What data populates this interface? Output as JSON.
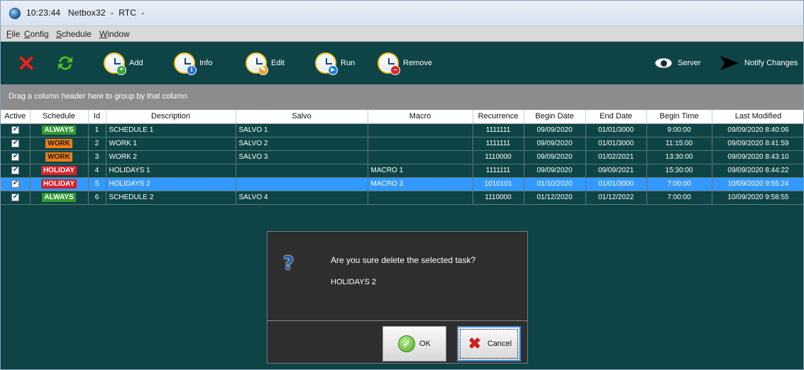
{
  "window": {
    "title": "10:23:44   Netbox32  -  RTC  -"
  },
  "menu": {
    "items": [
      "File",
      "Config",
      "Schedule",
      "Window"
    ]
  },
  "toolbar": {
    "add_label": "Add",
    "info_label": "Info",
    "edit_label": "Edit",
    "run_label": "Run",
    "remove_label": "Remove",
    "server_label": "Server",
    "notify_label": "Notify Changes"
  },
  "group_panel": {
    "hint": "Drag a column header here to group by that column"
  },
  "grid": {
    "columns": [
      "Active",
      "Schedule",
      "Id",
      "Description",
      "Salvo",
      "Macro",
      "Recurrence",
      "Begin Date",
      "End Date",
      "Begin Time",
      "Last Modified"
    ],
    "rows": [
      {
        "active": true,
        "schedule": "ALWAYS",
        "schedule_type": "always",
        "id": "1",
        "description": "SCHEDULE 1",
        "salvo": "SALVO 1",
        "macro": "",
        "recurrence": "1111111",
        "begin_date": "09/09/2020",
        "end_date": "01/01/3000",
        "begin_time": "9:00:00",
        "last_modified": "09/09/2020 8:40:06",
        "selected": false
      },
      {
        "active": true,
        "schedule": "WORK",
        "schedule_type": "work",
        "id": "2",
        "description": "WORK 1",
        "salvo": "SALVO 2",
        "macro": "",
        "recurrence": "1111111",
        "begin_date": "09/09/2020",
        "end_date": "01/01/3000",
        "begin_time": "11:15:00",
        "last_modified": "09/09/2020 8:41:59",
        "selected": false
      },
      {
        "active": true,
        "schedule": "WORK",
        "schedule_type": "work",
        "id": "3",
        "description": "WORK 2",
        "salvo": "SALVO 3",
        "macro": "",
        "recurrence": "1110000",
        "begin_date": "09/09/2020",
        "end_date": "01/02/2021",
        "begin_time": "13:30:00",
        "last_modified": "09/09/2020 8:43:10",
        "selected": false
      },
      {
        "active": true,
        "schedule": "HOLIDAY",
        "schedule_type": "holiday",
        "id": "4",
        "description": "HOLIDAYS 1",
        "salvo": "",
        "macro": "MACRO 1",
        "recurrence": "1111111",
        "begin_date": "09/09/2020",
        "end_date": "09/09/2021",
        "begin_time": "15:30:00",
        "last_modified": "09/09/2020 8:44:22",
        "selected": false
      },
      {
        "active": true,
        "schedule": "HOLIDAY",
        "schedule_type": "holiday",
        "id": "5",
        "description": "HOLIDAYS 2",
        "salvo": "",
        "macro": "MACRO 3",
        "recurrence": "1010101",
        "begin_date": "01/10/2020",
        "end_date": "01/01/3000",
        "begin_time": "7:00:00",
        "last_modified": "10/09/2020 9:55:24",
        "selected": true
      },
      {
        "active": true,
        "schedule": "ALWAYS",
        "schedule_type": "always",
        "id": "6",
        "description": "SCHEDULE 2",
        "salvo": "SALVO 4",
        "macro": "",
        "recurrence": "1110000",
        "begin_date": "01/12/2020",
        "end_date": "01/12/2022",
        "begin_time": "7:00:00",
        "last_modified": "10/09/2020 9:58:55",
        "selected": false
      }
    ]
  },
  "dialog": {
    "question": "Are you sure delete the selected task?",
    "item": "HOLIDAYS 2",
    "ok_label": "OK",
    "cancel_label": "Cancel"
  },
  "colors": {
    "toolbar_bg": "#0e4445",
    "grid_bg": "#0e4445",
    "selection": "#3399ff",
    "always_tag": "#2f9a2f",
    "work_tag": "#f07b12",
    "holiday_tag": "#d8212a"
  },
  "icons": {
    "delete": "red-x-icon",
    "refresh": "green-refresh-icon",
    "add": "clock-add-icon",
    "info": "clock-info-icon",
    "edit": "clock-edit-icon",
    "run": "clock-run-icon",
    "remove": "clock-remove-icon",
    "server": "eye-icon",
    "notify": "arrow-icon",
    "question": "question-icon",
    "ok": "check-icon",
    "cancel": "cancel-x-icon"
  }
}
